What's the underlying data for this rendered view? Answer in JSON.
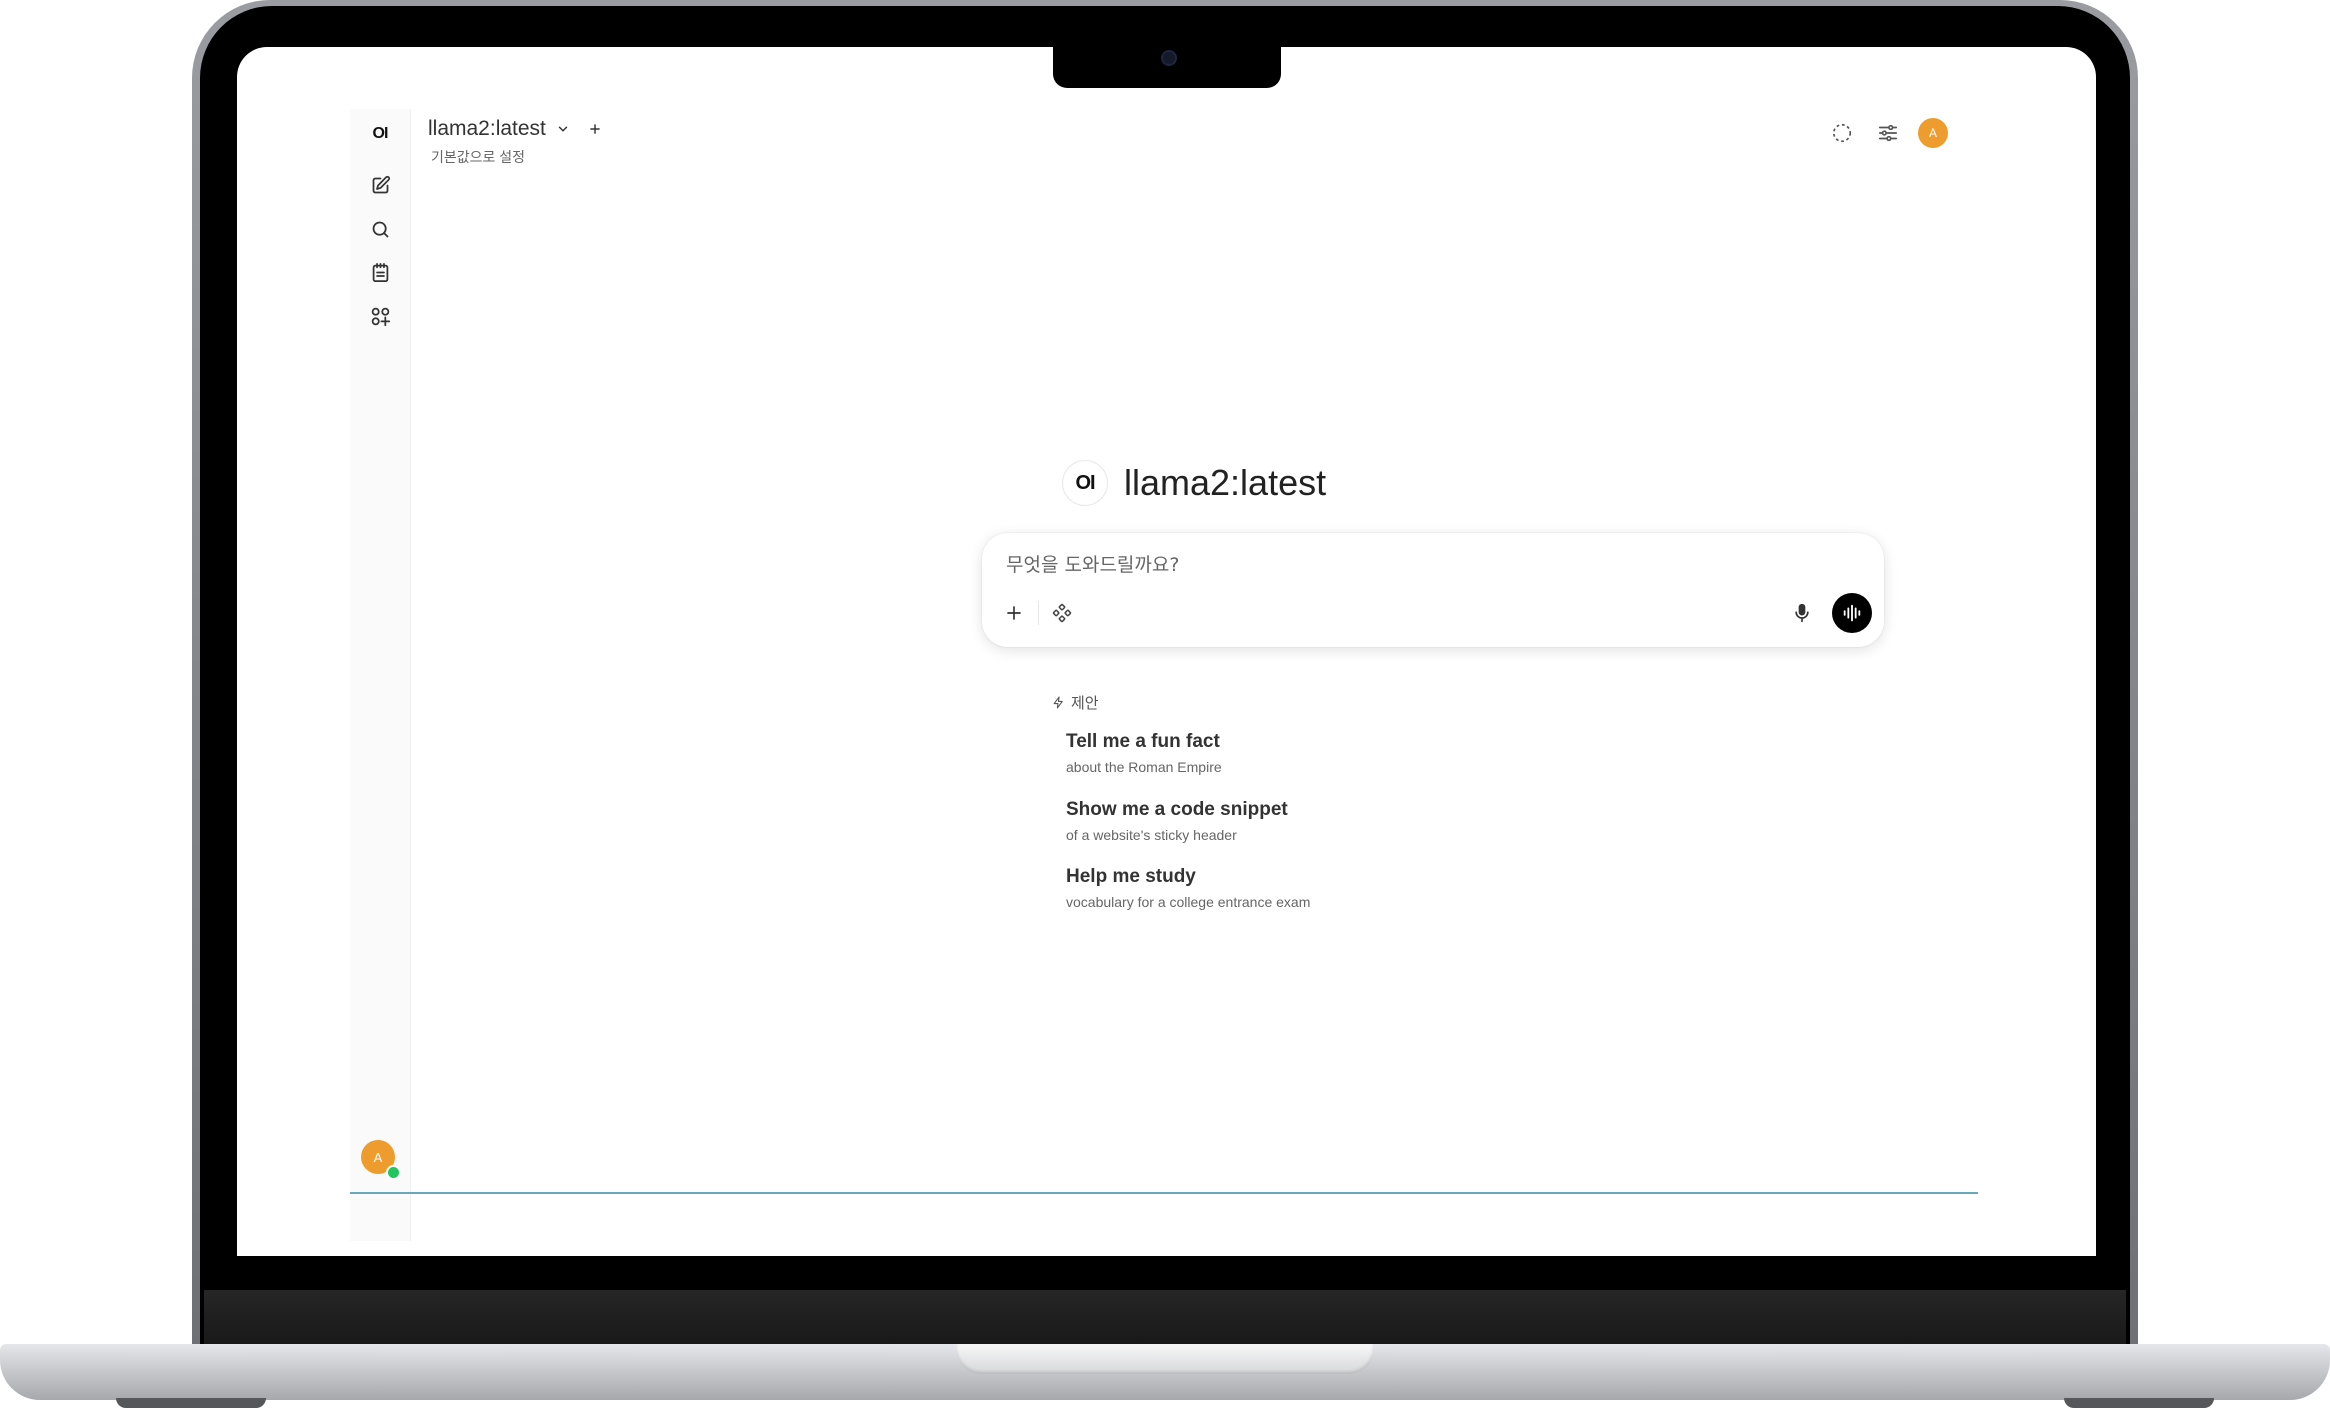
{
  "header": {
    "model_name": "llama2:latest",
    "set_default": "기본값으로 설정"
  },
  "hero": {
    "logo_text": "OI",
    "model_name": "llama2:latest"
  },
  "sidebar": {
    "logo_text": "OI",
    "user_initial": "A"
  },
  "top_right": {
    "user_initial": "A"
  },
  "chat": {
    "placeholder": "무엇을 도와드릴까요?"
  },
  "suggestions": {
    "heading": "제안",
    "items": [
      {
        "title": "Tell me a fun fact",
        "subtitle": "about the Roman Empire"
      },
      {
        "title": "Show me a code snippet",
        "subtitle": "of a website's sticky header"
      },
      {
        "title": "Help me study",
        "subtitle": "vocabulary for a college entrance exam"
      }
    ]
  },
  "colors": {
    "avatar": "#ee9c2e",
    "online": "#22c55e",
    "accent_line": "#6aa7b8"
  },
  "icons": [
    "new-chat-icon",
    "search-icon",
    "notes-icon",
    "workspace-icon",
    "chevron-down-icon",
    "plus-icon",
    "loading-circle-icon",
    "sliders-icon",
    "mic-icon",
    "voice-wave-icon",
    "tools-icon",
    "sparkle-icon"
  ]
}
